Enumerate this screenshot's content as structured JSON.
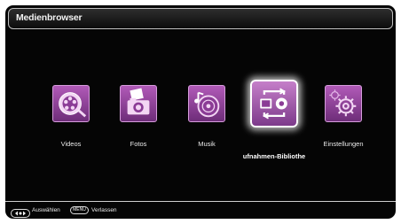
{
  "window": {
    "title": "Medienbrowser"
  },
  "menu": {
    "items": [
      {
        "label": "Videos",
        "icon": "film-reel-icon"
      },
      {
        "label": "Fotos",
        "icon": "camera-photo-icon"
      },
      {
        "label": "Musik",
        "icon": "music-disc-icon"
      },
      {
        "label": "ufnahmen-Bibliothe",
        "icon": "recordings-library-icon",
        "selected": true
      },
      {
        "label": "Einstellungen",
        "icon": "gears-icon"
      }
    ]
  },
  "footer": {
    "select_hint": "Auswählen",
    "menu_key": "MENU",
    "exit_hint": "Verlassen"
  },
  "colors": {
    "accent": "#9b4aa5",
    "background": "#050505"
  }
}
